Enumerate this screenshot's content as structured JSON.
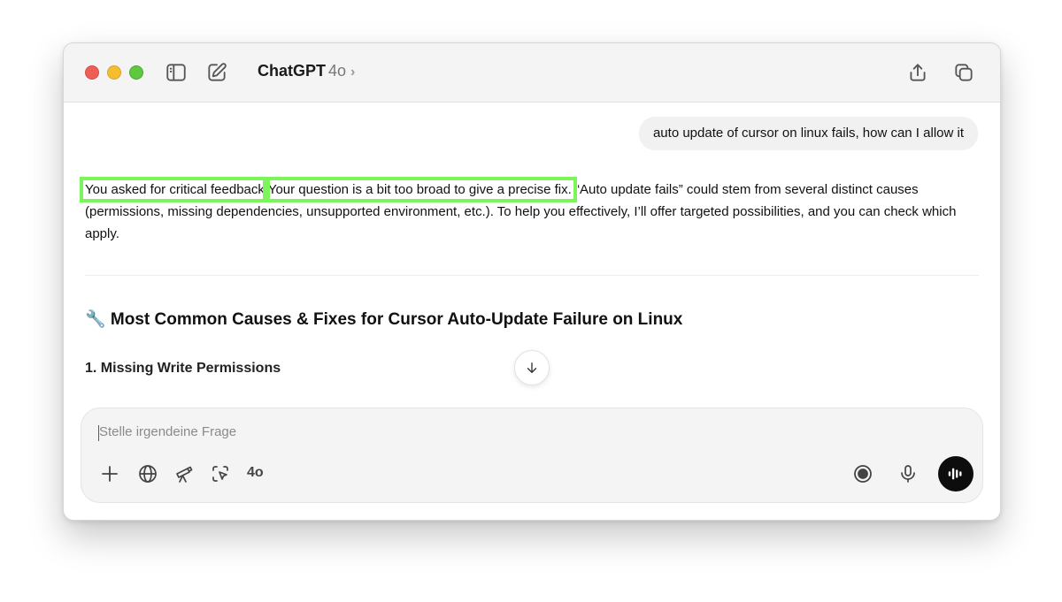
{
  "app": {
    "title": "ChatGPT",
    "model": "4o",
    "chevron": "›"
  },
  "chat": {
    "user_message": "auto update of cursor on linux fails, how can I allow it",
    "answer": {
      "highlight_1": "You asked for critical feedback",
      "highlight_2": "Your question is a bit too broad to give a precise fix.",
      "rest": " “Auto update fails” could stem from several distinct causes (permissions, missing dependencies, unsupported environment, etc.). To help you effectively, I’ll offer targeted possibilities, and you can check which apply."
    },
    "section_heading": "🔧 Most Common Causes & Fixes for Cursor Auto-Update Failure on Linux",
    "sub_heading": "1. Missing Write Permissions"
  },
  "composer": {
    "placeholder": "Stelle irgendeine Frage",
    "value": "",
    "model_chip": "4o"
  },
  "icons": {
    "sidebar": "sidebar-toggle-icon",
    "new_chat": "compose-icon",
    "share": "share-icon",
    "new_window": "new-window-icon",
    "scroll_down": "arrow-down-icon",
    "attach": "plus-icon",
    "web": "globe-icon",
    "research": "telescope-icon",
    "screen": "screen-select-icon",
    "record": "record-icon",
    "mic": "microphone-icon",
    "voice": "voice-mode-icon"
  },
  "colors": {
    "highlight": "#7cf55a",
    "voice_button": "#0d0d0d",
    "bubble": "#f1f1f1"
  }
}
